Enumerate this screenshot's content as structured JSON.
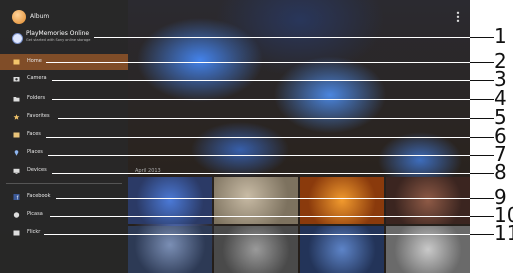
{
  "app": {
    "title": "Album",
    "overflow_icon": "overflow-menu-icon"
  },
  "playmemories": {
    "title": "PlayMemories Online",
    "subtitle": "Get started with Sony online storage",
    "icon": "playmemories-icon"
  },
  "menu": [
    {
      "label": "Home",
      "icon": "home-icon",
      "selected": true
    },
    {
      "label": "Camera",
      "icon": "camera-icon"
    },
    {
      "label": "Folders",
      "icon": "folder-icon"
    },
    {
      "label": "Favorites",
      "icon": "star-icon"
    },
    {
      "label": "Faces",
      "icon": "faces-icon"
    },
    {
      "label": "Places",
      "icon": "places-icon"
    },
    {
      "label": "Devices",
      "icon": "devices-icon"
    },
    {
      "label": "Facebook",
      "icon": "facebook-icon"
    },
    {
      "label": "Picasa",
      "icon": "picasa-icon"
    },
    {
      "label": "Flickr",
      "icon": "flickr-icon"
    }
  ],
  "grid_label": "April 2013",
  "callouts": [
    "1",
    "2",
    "3",
    "4",
    "5",
    "6",
    "7",
    "8",
    "9",
    "10",
    "11"
  ],
  "colors": {
    "drawer_bg": "#282828",
    "selected_bg": "#c86e28",
    "accent": "#e08a2c"
  }
}
